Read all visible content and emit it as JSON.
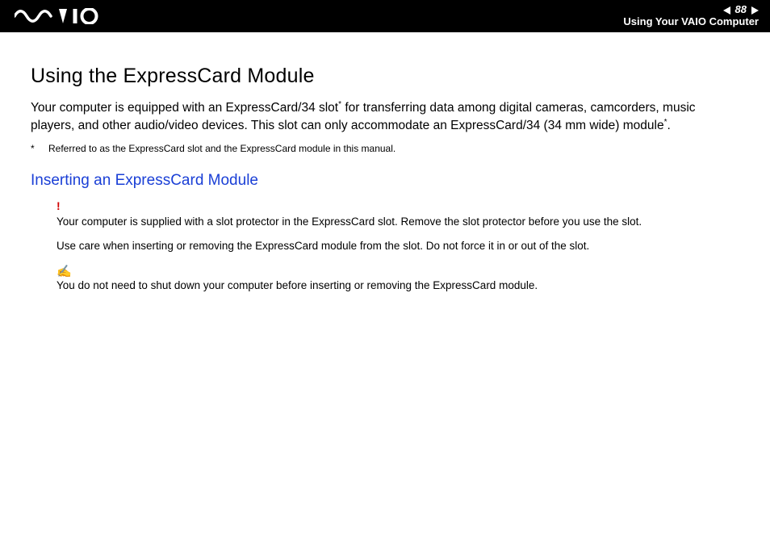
{
  "header": {
    "page_number": "88",
    "section": "Using Your VAIO Computer"
  },
  "content": {
    "title": "Using the ExpressCard Module",
    "intro_part1": "Your computer is equipped with an ExpressCard/34 slot",
    "intro_star1": "*",
    "intro_part2": " for transferring data among digital cameras, camcorders, music players, and other audio/video devices. This slot can only accommodate an ExpressCard/34 (34 mm wide) module",
    "intro_star2": "*",
    "intro_part3": ".",
    "footnote_mark": "*",
    "footnote_text": "Referred to as the ExpressCard slot and the ExpressCard module in this manual.",
    "subtitle": "Inserting an ExpressCard Module",
    "alert_symbol": "!",
    "alert_line1": "Your computer is supplied with a slot protector in the ExpressCard slot. Remove the slot protector before you use the slot.",
    "alert_line2": "Use care when inserting or removing the ExpressCard module from the slot. Do not force it in or out of the slot.",
    "pencil_symbol": "✍",
    "note_line": "You do not need to shut down your computer before inserting or removing the ExpressCard module."
  }
}
